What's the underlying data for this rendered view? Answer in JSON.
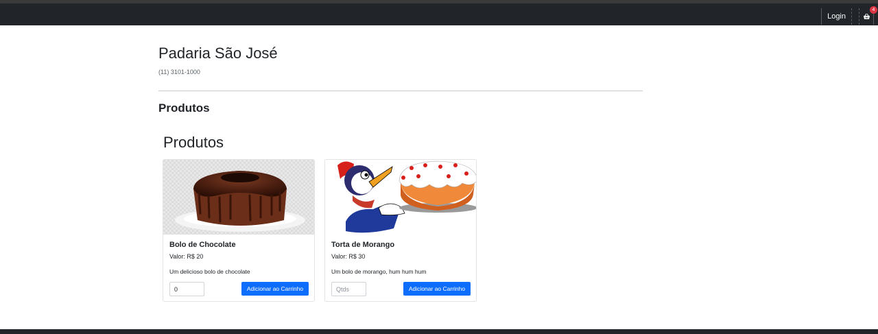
{
  "nav": {
    "login_label": "Login",
    "cart_icon": "basket-icon",
    "cart_count": "4"
  },
  "shop": {
    "title": "Padaria São José",
    "phone": "(11) 3101-1000"
  },
  "section_sub": "Produtos",
  "section_main": "Produtos",
  "products": [
    {
      "name": "Bolo de Chocolate",
      "price": "Valor: R$ 20",
      "description": "Um delicioso bolo de chocolate",
      "qty_value": "0",
      "qty_placeholder": "Qtds",
      "button_label": "Adicionar ao Carrinho"
    },
    {
      "name": "Torta de Morango",
      "price": "Valor: R$ 30",
      "description": "Um bolo de morango, hum hum hum",
      "qty_value": "",
      "qty_placeholder": "Qtds",
      "button_label": "Adicionar ao Carrinho"
    }
  ],
  "colors": {
    "navbar": "#212529",
    "primary": "#0d6efd",
    "badge": "#dc3545"
  }
}
